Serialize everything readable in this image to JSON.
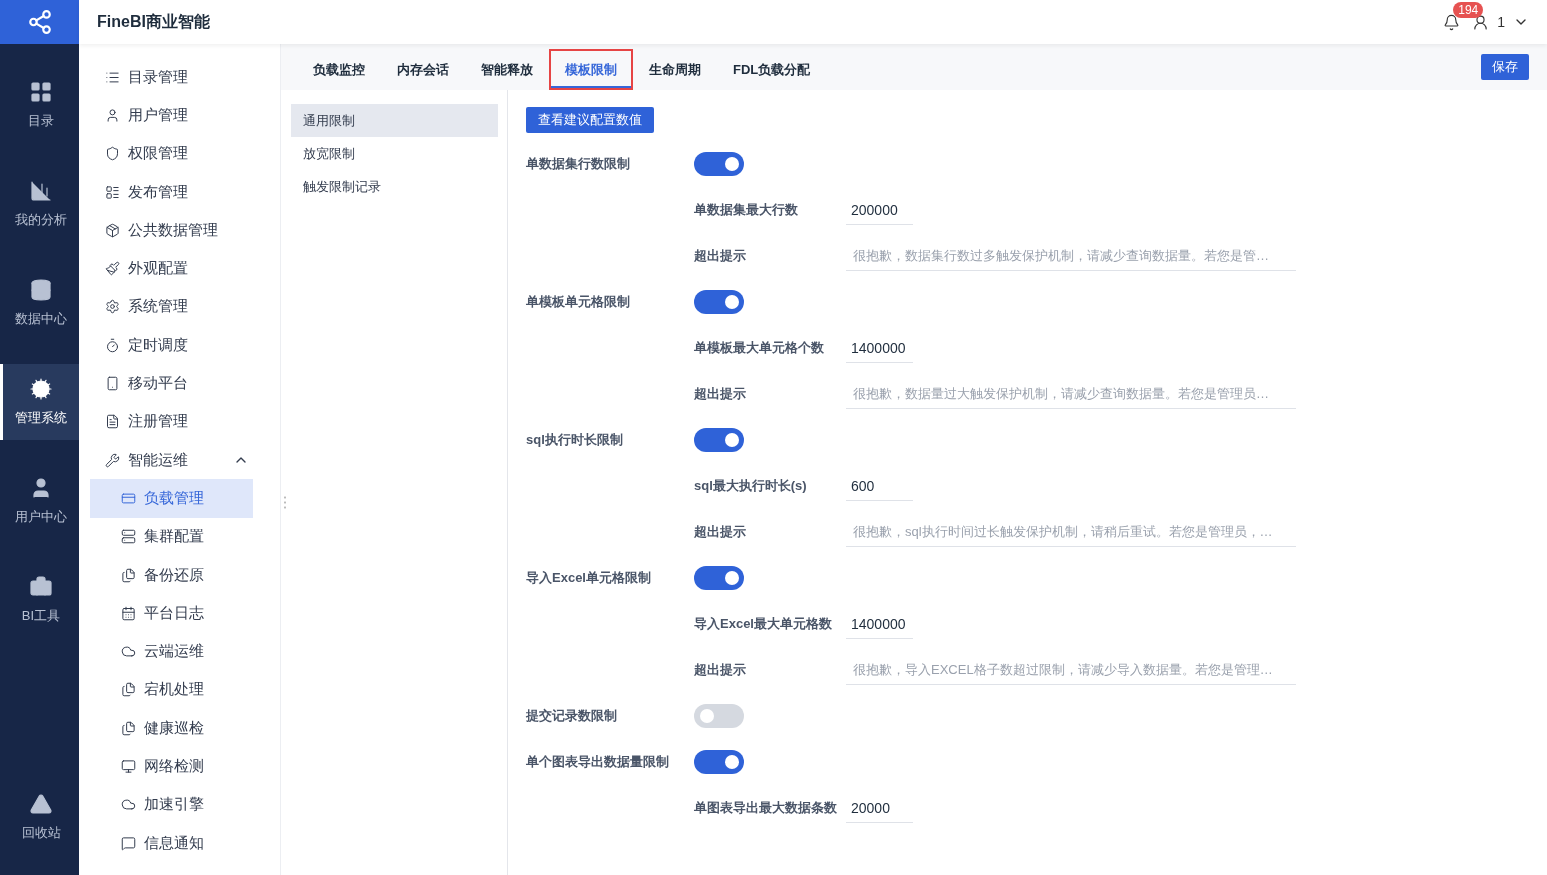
{
  "header": {
    "title": "FineBI商业智能",
    "notification_count": "194",
    "user": "1"
  },
  "rail": [
    {
      "label": "目录",
      "selected": false
    },
    {
      "label": "我的分析",
      "selected": false
    },
    {
      "label": "数据中心",
      "selected": false
    },
    {
      "label": "管理系统",
      "selected": true
    },
    {
      "label": "用户中心",
      "selected": false
    },
    {
      "label": "BI工具",
      "selected": false
    },
    {
      "label": "回收站",
      "selected": false
    }
  ],
  "menu": [
    {
      "label": "目录管理",
      "selected": false
    },
    {
      "label": "用户管理",
      "selected": false
    },
    {
      "label": "权限管理",
      "selected": false
    },
    {
      "label": "发布管理",
      "selected": false
    },
    {
      "label": "公共数据管理",
      "selected": false
    },
    {
      "label": "外观配置",
      "selected": false
    },
    {
      "label": "系统管理",
      "selected": false
    },
    {
      "label": "定时调度",
      "selected": false
    },
    {
      "label": "移动平台",
      "selected": false
    },
    {
      "label": "注册管理",
      "selected": false
    },
    {
      "label": "智能运维",
      "selected": false,
      "expanded": true,
      "children": [
        {
          "label": "负载管理",
          "selected": true
        },
        {
          "label": "集群配置",
          "selected": false
        },
        {
          "label": "备份还原",
          "selected": false
        },
        {
          "label": "平台日志",
          "selected": false
        },
        {
          "label": "云端运维",
          "selected": false
        },
        {
          "label": "宕机处理",
          "selected": false
        },
        {
          "label": "健康巡检",
          "selected": false
        },
        {
          "label": "网络检测",
          "selected": false
        },
        {
          "label": "加速引擎",
          "selected": false
        },
        {
          "label": "信息通知",
          "selected": false
        }
      ]
    }
  ],
  "tabs": [
    {
      "label": "负载监控",
      "selected": false
    },
    {
      "label": "内存会话",
      "selected": false
    },
    {
      "label": "智能释放",
      "selected": false
    },
    {
      "label": "模板限制",
      "selected": true
    },
    {
      "label": "生命周期",
      "selected": false
    },
    {
      "label": "FDL负载分配",
      "selected": false
    }
  ],
  "save_button": "保存",
  "subnav": [
    {
      "label": "通用限制",
      "selected": true
    },
    {
      "label": "放宽限制",
      "selected": false
    },
    {
      "label": "触发限制记录",
      "selected": false
    }
  ],
  "suggest_button": "查看建议配置数值",
  "limits": [
    {
      "label": "单数据集行数限制",
      "on": true,
      "settings": [
        {
          "kind": "number",
          "label": "单数据集最大行数",
          "value": "200000"
        },
        {
          "kind": "hint",
          "label": "超出提示",
          "placeholder": "很抱歉，数据集行数过多触发保护机制，请减少查询数据量。若您是管…"
        }
      ]
    },
    {
      "label": "单模板单元格限制",
      "on": true,
      "settings": [
        {
          "kind": "number",
          "label": "单模板最大单元格个数",
          "value": "1400000"
        },
        {
          "kind": "hint",
          "label": "超出提示",
          "placeholder": "很抱歉，数据量过大触发保护机制，请减少查询数据量。若您是管理员…"
        }
      ]
    },
    {
      "label": "sql执行时长限制",
      "on": true,
      "settings": [
        {
          "kind": "number",
          "label": "sql最大执行时长(s)",
          "value": "600"
        },
        {
          "kind": "hint",
          "label": "超出提示",
          "placeholder": "很抱歉，sql执行时间过长触发保护机制，请稍后重试。若您是管理员，…"
        }
      ]
    },
    {
      "label": "导入Excel单元格限制",
      "on": true,
      "settings": [
        {
          "kind": "number",
          "label": "导入Excel最大单元格数",
          "value": "1400000"
        },
        {
          "kind": "hint",
          "label": "超出提示",
          "placeholder": "很抱歉，导入EXCEL格子数超过限制，请减少导入数据量。若您是管理…"
        }
      ]
    },
    {
      "label": "提交记录数限制",
      "on": false
    },
    {
      "label": "单个图表导出数据量限制",
      "on": true,
      "settings": [
        {
          "kind": "number",
          "label": "单图表导出最大数据条数",
          "value": "20000"
        }
      ]
    }
  ]
}
